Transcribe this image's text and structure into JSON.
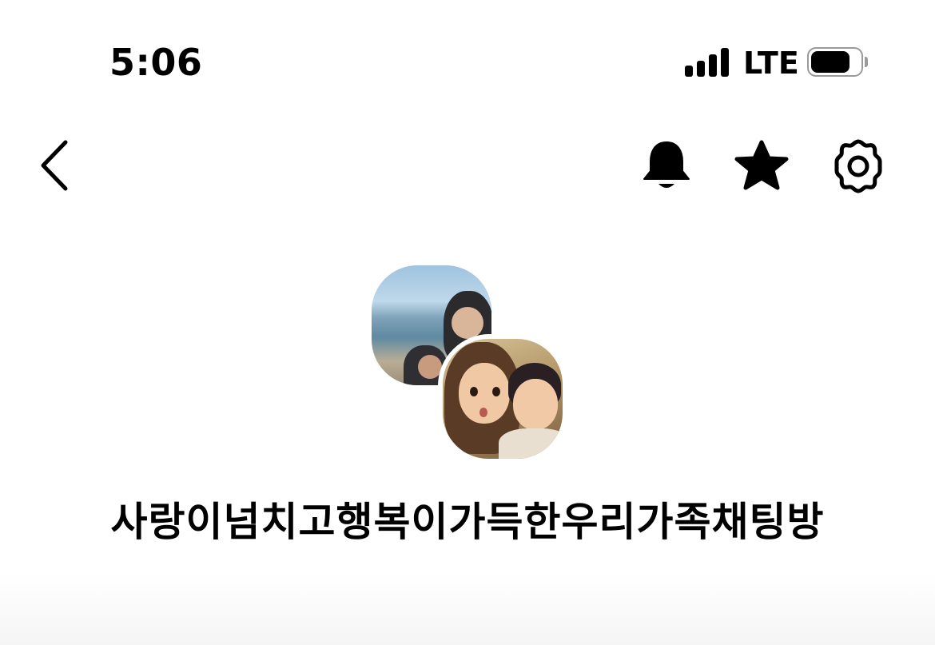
{
  "status_bar": {
    "time": "5:06",
    "network": "LTE",
    "signal_icon": "signal-bars-icon",
    "battery_icon": "battery-icon"
  },
  "nav": {
    "back_icon": "chevron-left-icon",
    "notification_icon": "bell-icon",
    "favorite_icon": "star-icon",
    "settings_icon": "gear-icon"
  },
  "chat_room": {
    "title": "사랑이넘치고행복이가득한우리가족채팅방",
    "avatars": [
      "beach-photo-avatar",
      "illustrated-family-avatar"
    ]
  }
}
